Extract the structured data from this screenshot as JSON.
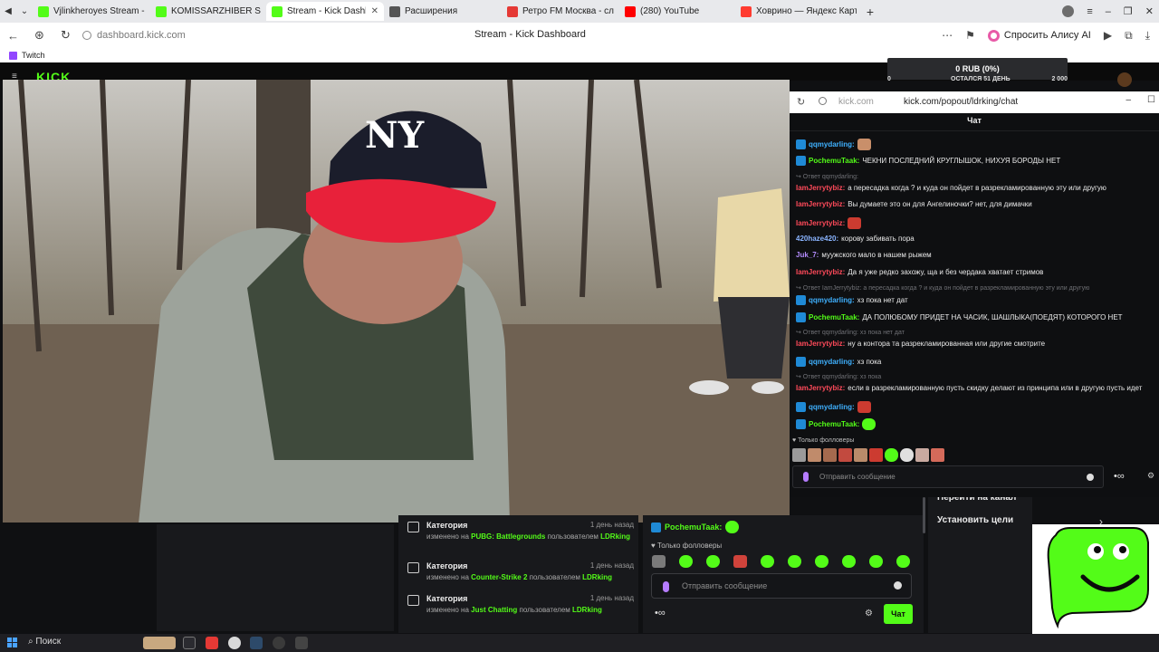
{
  "browser": {
    "tabs": [
      {
        "label": "Vjlinkheroyes Stream - Wa",
        "favicon": "#53fc18",
        "active": false
      },
      {
        "label": "KOMISSARZHIBER S",
        "favicon": "#53fc18",
        "active": false
      },
      {
        "label": "Stream - Kick Dashboar",
        "favicon": "#53fc18",
        "active": true
      },
      {
        "label": "Расширения",
        "favicon": "puzzle",
        "active": false
      },
      {
        "label": "Ретро FM Москва - слуш",
        "favicon": "#e53935",
        "active": false
      },
      {
        "label": "(280) YouTube",
        "favicon": "#ff0000",
        "active": false
      },
      {
        "label": "Ховрино — Яндекс Карт",
        "favicon": "#ff3b30",
        "active": false
      }
    ],
    "url": "dashboard.kick.com",
    "page_title": "Stream - Kick Dashboard",
    "alice_label": "Спросить Алису AI",
    "bookmark": "Twitch"
  },
  "goal": {
    "amount": "0 RUB (0%)",
    "left": "0",
    "remaining": "ОСТАЛСЯ 51 ДЕНЬ",
    "target": "2 000"
  },
  "activity": [
    {
      "heading": "Категория",
      "time": "1 день назад",
      "prefix": "изменено на",
      "category": "PUBG: Battlegrounds",
      "by": "пользователем",
      "user": "LDRking"
    },
    {
      "heading": "Категория",
      "time": "1 день назад",
      "prefix": "изменено на",
      "category": "Counter-Strike 2",
      "by": "пользователем",
      "user": "LDRking"
    },
    {
      "heading": "Категория",
      "time": "1 день назад",
      "prefix": "изменено на",
      "category": "Just Chatting",
      "by": "пользователем",
      "user": "LDRking"
    }
  ],
  "mini_chat": {
    "user": "PochemuTaak:",
    "followers_only": "Только фолловеры",
    "placeholder": "Отправить сообщение",
    "chat_button": "Чат"
  },
  "side_links": {
    "channel": "Перейти на канал",
    "goals": "Установить цели"
  },
  "popout": {
    "domain": "kick.com",
    "path": "kick.com/popout/ldrking/chat",
    "title": "Чат",
    "followers_only": "Только фолловеры",
    "placeholder": "Отправить сообщение",
    "messages": [
      {
        "type": "msg",
        "user": "qqmydarling:",
        "color": "#3fb1ff",
        "text": "",
        "emote": "skin",
        "badge": true
      },
      {
        "type": "msg",
        "user": "PochemuTaak:",
        "color": "#53fc18",
        "text": "ЧЕКНИ ПОСЛЕДНИЙ КРУГЛЫШОК, НИХУЯ БОРОДЫ НЕТ",
        "badge": true
      },
      {
        "type": "reply",
        "text": "↪ Ответ qqmydarling:"
      },
      {
        "type": "msg",
        "user": "IamJerrytybiz:",
        "color": "#ff4a5a",
        "text": "а пересадка когда ? и куда он пойдет в разрекламированную эту или другую"
      },
      {
        "type": "msg",
        "user": "IamJerrytybiz:",
        "color": "#ff4a5a",
        "text": "Вы думаете это он для Ангелиночки? нет, для димачки"
      },
      {
        "type": "msg",
        "user": "IamJerrytybiz:",
        "color": "#ff4a5a",
        "text": "",
        "emote": "red"
      },
      {
        "type": "msg",
        "user": "420haze420:",
        "color": "#8ab4ff",
        "text": "корову забивать пора"
      },
      {
        "type": "msg",
        "user": "Juk_7:",
        "color": "#b48cff",
        "text": "муужского мало в нашем рыжем"
      },
      {
        "type": "msg",
        "user": "IamJerrytybiz:",
        "color": "#ff4a5a",
        "text": "Да я уже редко захожу, ща и без чердака хватает стримов"
      },
      {
        "type": "reply",
        "text": "↪ Ответ IamJerrytybiz: а пересадка когда ? и куда он пойдет в разрекламированную эту или другую"
      },
      {
        "type": "msg",
        "user": "qqmydarling:",
        "color": "#3fb1ff",
        "text": "хз пока нет дат",
        "badge": true
      },
      {
        "type": "msg",
        "user": "PochemuTaak:",
        "color": "#53fc18",
        "text": "ДА ПОЛЮБОМУ ПРИДЕТ НА ЧАСИК, ШАШЛЫКА(ПОЕДЯТ) КОТОРОГО НЕТ",
        "badge": true
      },
      {
        "type": "reply",
        "text": "↪ Ответ qqmydarling: хз пока нет дат"
      },
      {
        "type": "msg",
        "user": "IamJerrytybiz:",
        "color": "#ff4a5a",
        "text": "ну а контора та разрекламированная или другие смотрите"
      },
      {
        "type": "msg",
        "user": "qqmydarling:",
        "color": "#3fb1ff",
        "text": "хз пока",
        "badge": true
      },
      {
        "type": "reply",
        "text": "↪ Ответ qqmydarling: хз пока"
      },
      {
        "type": "msg",
        "user": "IamJerrytybiz:",
        "color": "#ff4a5a",
        "text": "если в разрекламированную пусть скидку делают из принципа или в другую пусть идет"
      },
      {
        "type": "msg",
        "user": "qqmydarling:",
        "color": "#3fb1ff",
        "text": "",
        "emote": "red",
        "badge": true
      },
      {
        "type": "msg",
        "user": "PochemuTaak:",
        "color": "#53fc18",
        "text": "",
        "emote": "green",
        "badge": true
      }
    ]
  },
  "taskbar": {
    "search": "Поиск"
  }
}
